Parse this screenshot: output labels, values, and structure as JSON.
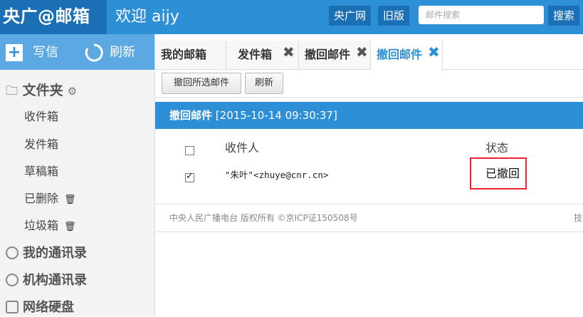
{
  "header": {
    "logo": "央广@邮箱",
    "welcome": "欢迎 aijy",
    "cnr_link": "央广网",
    "old_version": "旧版",
    "search_placeholder": "邮件搜索",
    "search_button": "搜索"
  },
  "sidebar": {
    "write": "写信",
    "refresh": "刷新",
    "folders_title": "文件夹",
    "folders": [
      "收件箱",
      "发件箱",
      "草稿箱",
      "已删除",
      "垃圾箱"
    ],
    "sections": [
      "我的通讯录",
      "机构通讯录",
      "网络硬盘"
    ]
  },
  "tabs": [
    "我的邮箱",
    "发件箱",
    "撤回邮件",
    "撤回邮件"
  ],
  "toolbar": {
    "recall_selected": "撤回所选邮件",
    "refresh": "刷新"
  },
  "recall_header": {
    "title": "撤回邮件",
    "timestamp": "[2015-10-14 09:30:37]"
  },
  "table": {
    "col_recipient": "收件人",
    "col_status": "状态",
    "rows": [
      {
        "recipient": "\"朱叶\"<zhuye@cnr.cn>",
        "status": "已撤回",
        "checked": true
      }
    ]
  },
  "footer": {
    "copyright": "中央人民广播电台 版权所有 ©京ICP证150508号",
    "right": "技"
  },
  "colors": {
    "brand": "#2d8fd6",
    "brand_dark": "#1b6fb5",
    "highlight": "#e22233"
  }
}
